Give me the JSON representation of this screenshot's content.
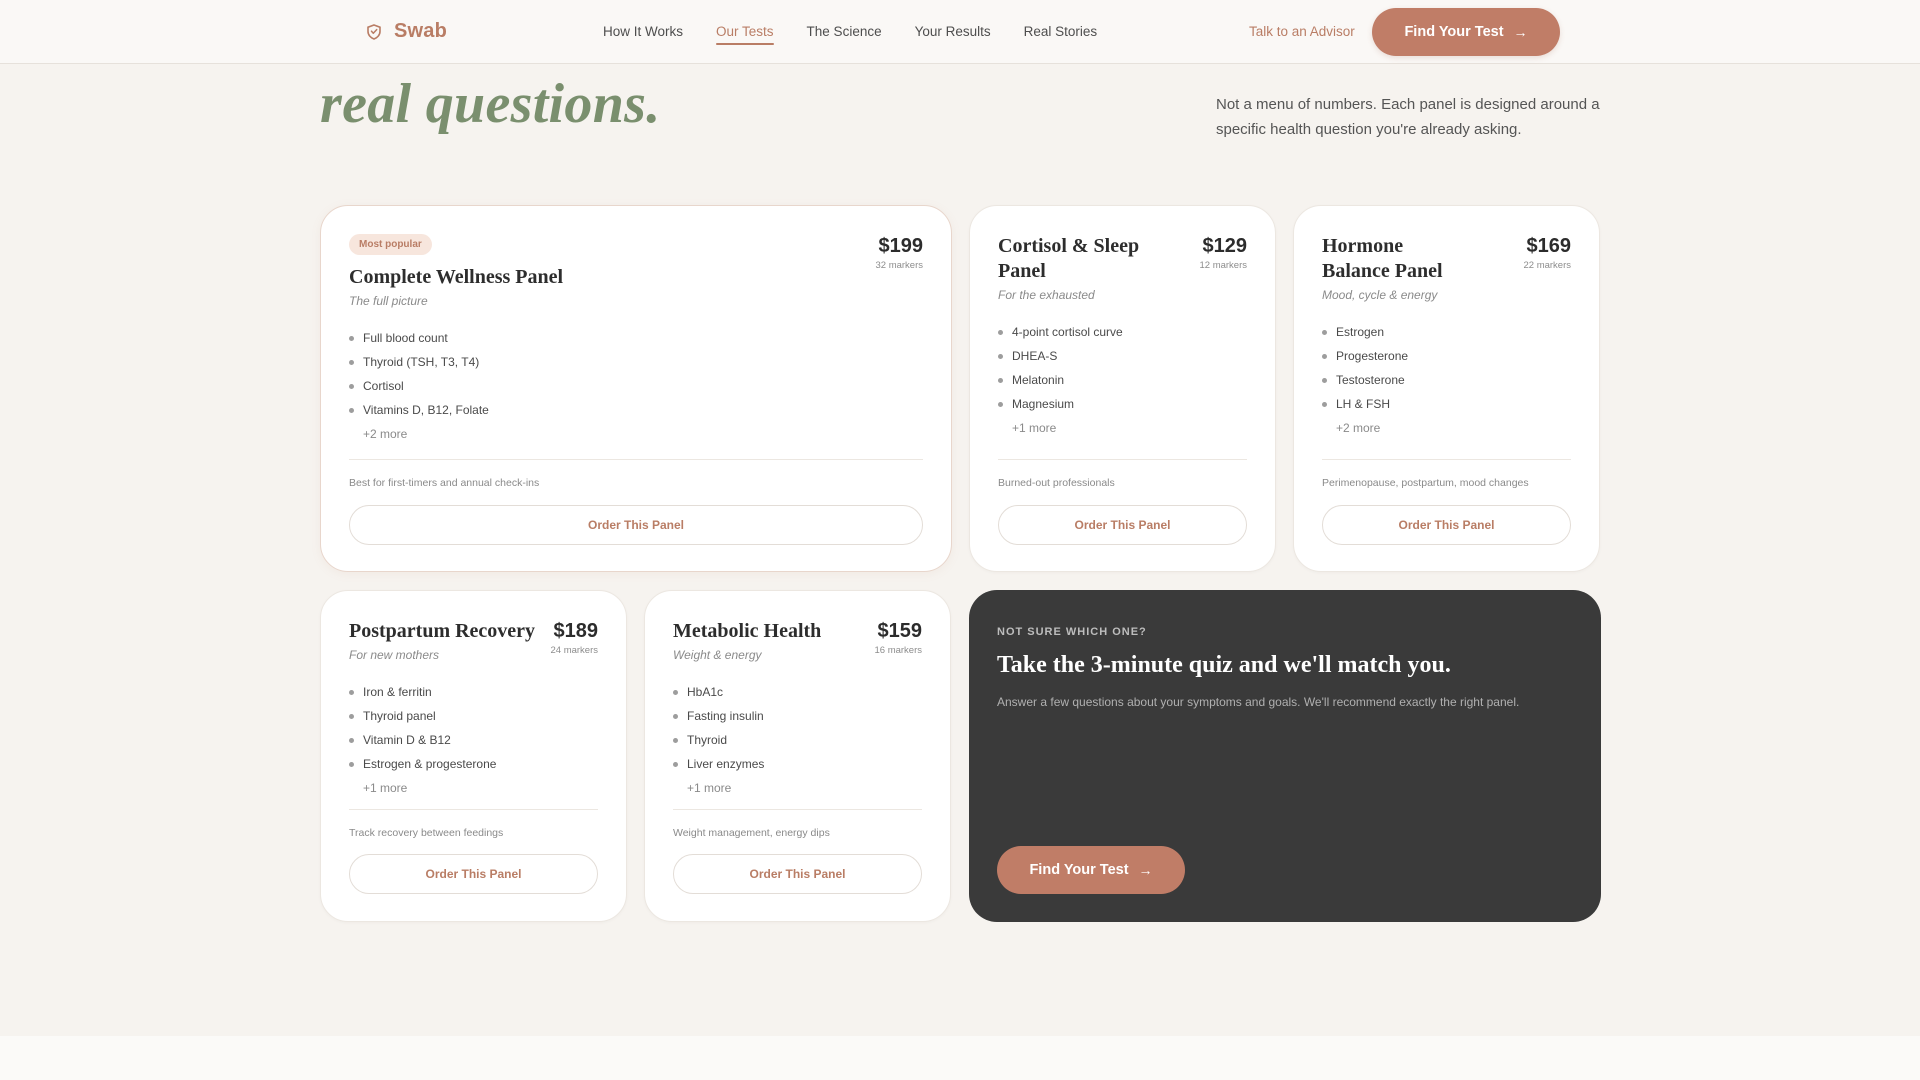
{
  "nav": {
    "brand": "Swab",
    "links": [
      "How It Works",
      "Our Tests",
      "The Science",
      "Your Results",
      "Real Stories"
    ],
    "active_index": 1,
    "advisor": "Talk to an Advisor",
    "cta": "Find Your Test"
  },
  "hero": {
    "title": "real questions.",
    "subtitle": "Not a menu of numbers. Each panel is designed around a specific health question you're already asking."
  },
  "panels": [
    {
      "badge": "Most popular",
      "title": "Complete Wellness Panel",
      "subtitle": "The full picture",
      "price": "$199",
      "markers": "32 markers",
      "items": [
        "Full blood count",
        "Thyroid (TSH, T3, T4)",
        "Cortisol",
        "Vitamins D, B12, Folate"
      ],
      "more": "+2 more",
      "best_for": "Best for first-timers and annual check-ins",
      "button": "Order This Panel"
    },
    {
      "title": "Cortisol & Sleep Panel",
      "subtitle": "For the exhausted",
      "price": "$129",
      "markers": "12 markers",
      "items": [
        "4-point cortisol curve",
        "DHEA-S",
        "Melatonin",
        "Magnesium"
      ],
      "more": "+1 more",
      "best_for": "Burned-out professionals",
      "button": "Order This Panel"
    },
    {
      "title": "Hormone Balance Panel",
      "subtitle": "Mood, cycle & energy",
      "price": "$169",
      "markers": "22 markers",
      "items": [
        "Estrogen",
        "Progesterone",
        "Testosterone",
        "LH & FSH"
      ],
      "more": "+2 more",
      "best_for": "Perimenopause, postpartum, mood changes",
      "button": "Order This Panel"
    },
    {
      "title": "Postpartum Recovery",
      "subtitle": "For new mothers",
      "price": "$189",
      "markers": "24 markers",
      "items": [
        "Iron & ferritin",
        "Thyroid panel",
        "Vitamin D & B12",
        "Estrogen & progesterone"
      ],
      "more": "+1 more",
      "best_for": "Track recovery between feedings",
      "button": "Order This Panel"
    },
    {
      "title": "Metabolic Health",
      "subtitle": "Weight & energy",
      "price": "$159",
      "markers": "16 markers",
      "items": [
        "HbA1c",
        "Fasting insulin",
        "Thyroid",
        "Liver enzymes"
      ],
      "more": "+1 more",
      "best_for": "Weight management, energy dips",
      "button": "Order This Panel"
    }
  ],
  "quiz": {
    "eyebrow": "NOT SURE WHICH ONE?",
    "title": "Take the 3-minute quiz and we'll match you.",
    "description": "Answer a few questions about your symptoms and goals. We'll recommend exactly the right panel.",
    "button": "Find Your Test"
  },
  "colors": {
    "accent": "#c07d67",
    "sage": "#7a8f6e",
    "dark_card": "#3a3a3a",
    "page_bg": "#f6f3ef"
  }
}
